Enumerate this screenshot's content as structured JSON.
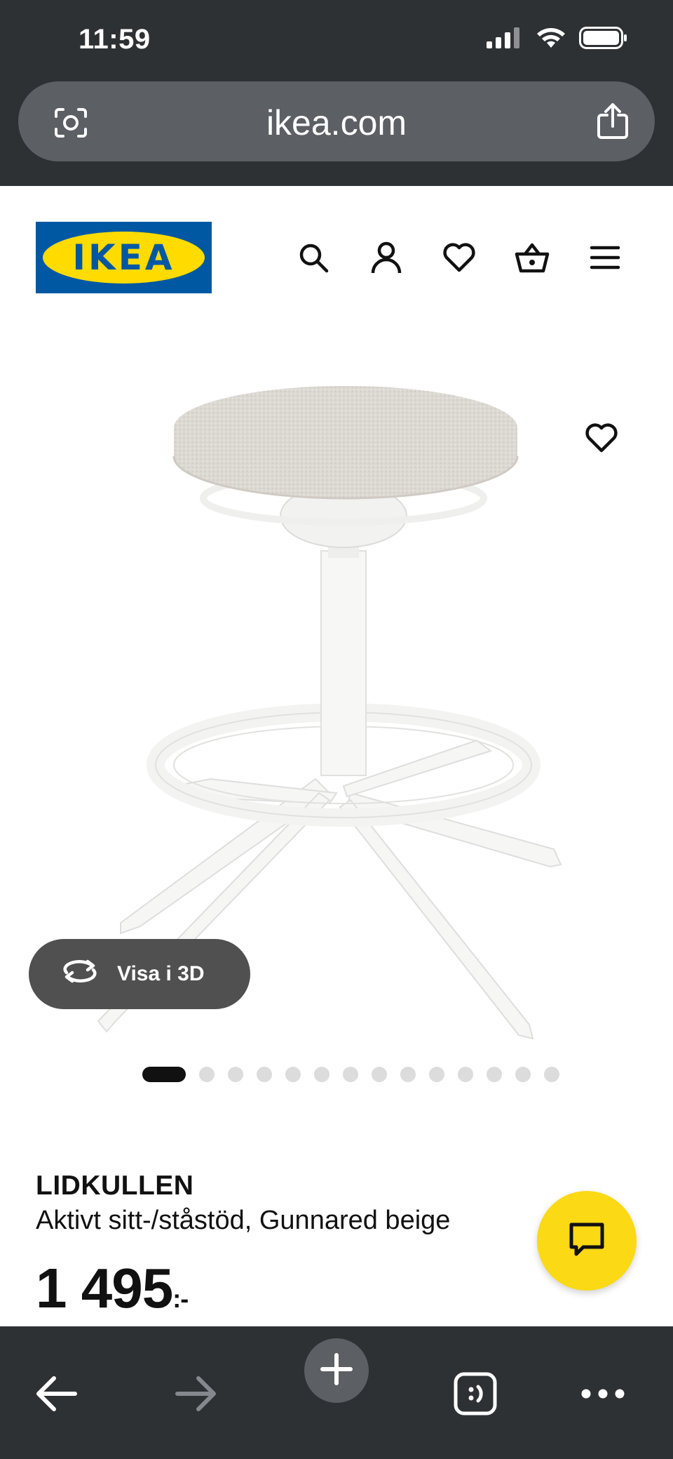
{
  "status_bar": {
    "time": "11:59",
    "icons": [
      "signal-icon",
      "wifi-icon",
      "battery-icon"
    ]
  },
  "browser": {
    "url": "ikea.com",
    "icons": [
      "lens-icon",
      "share-icon"
    ],
    "toolbar_icons": [
      "back-icon",
      "forward-icon",
      "new-tab-icon",
      "tabs-icon",
      "more-icon"
    ]
  },
  "header": {
    "logo_text": "IKEA",
    "icons": [
      "search-icon",
      "account-icon",
      "heart-icon",
      "basket-icon",
      "menu-icon"
    ],
    "colors": {
      "logo_blue": "#0058a3",
      "logo_yellow": "#ffdb00"
    }
  },
  "gallery": {
    "view_3d_label": "Visa i 3D",
    "image_count": 14,
    "active_index": 0
  },
  "product": {
    "name": "LIDKULLEN",
    "description": "Aktivt sitt-/ståstöd, Gunnared beige",
    "price": "1 495",
    "price_suffix": ":-"
  },
  "chat": {
    "icon": "chat-icon",
    "color": "#fbd914"
  }
}
